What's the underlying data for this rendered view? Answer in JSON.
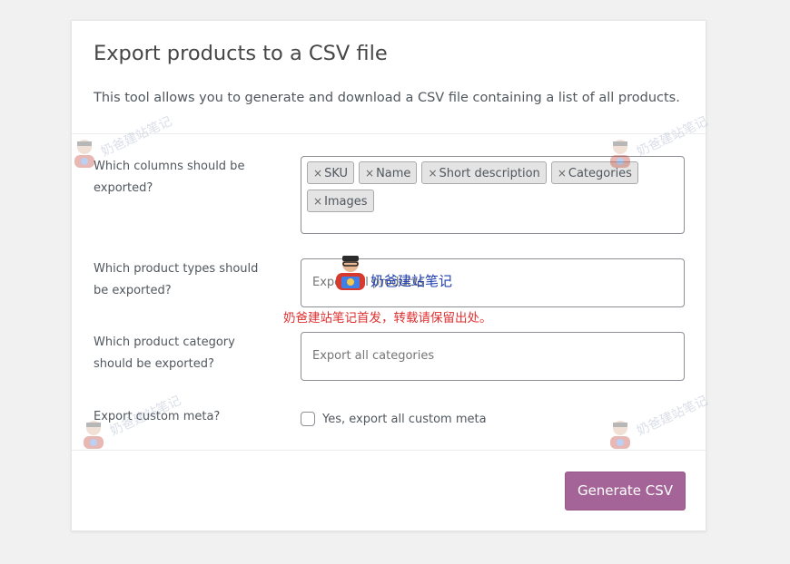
{
  "page": {
    "title": "Export products to a CSV file",
    "description": "This tool allows you to generate and download a CSV file containing a list of all products."
  },
  "fields": {
    "columns": {
      "label": "Which columns should be exported?",
      "tags": [
        "SKU",
        "Name",
        "Short description",
        "Categories",
        "Images"
      ],
      "remove_glyph": "×"
    },
    "product_types": {
      "label": "Which product types should be exported?",
      "placeholder": "Export all products"
    },
    "category": {
      "label": "Which product category should be exported?",
      "placeholder": "Export all categories"
    },
    "meta": {
      "label": "Export custom meta?",
      "checkbox_label": "Yes, export all custom meta",
      "checked": false
    }
  },
  "actions": {
    "generate_label": "Generate CSV"
  },
  "watermark": {
    "text": "奶爸建站笔记",
    "notice": "奶爸建站笔记首发，转载请保留出处。"
  },
  "colors": {
    "accent": "#a46497",
    "notice": "#e03131",
    "watermark_blue": "#1f3fae"
  }
}
